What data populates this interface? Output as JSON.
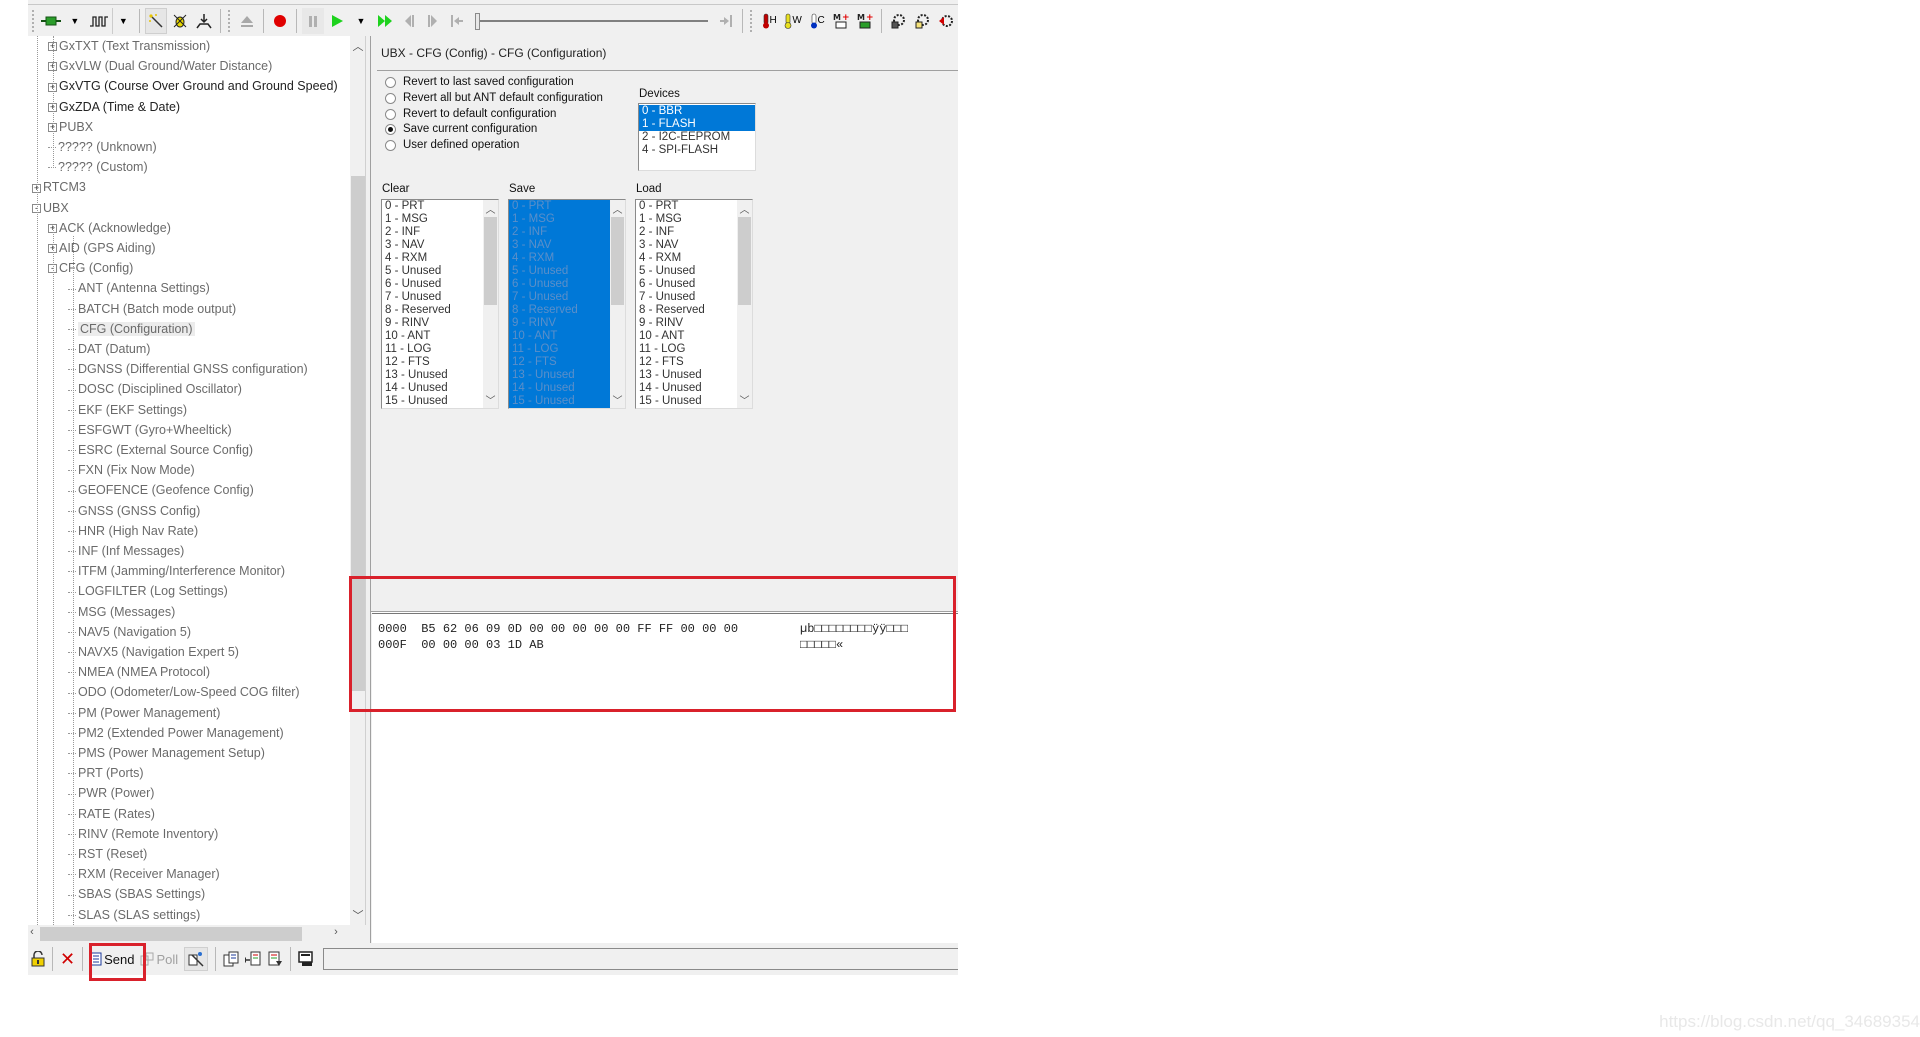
{
  "toolbar": {
    "icons": [
      "connection-icon",
      "baudrate-icon",
      "autobaud-icon",
      "debug-icon",
      "receive-icon",
      "eject-icon",
      "record-icon",
      "pause-icon",
      "play-icon",
      "play-menu-icon",
      "fast-forward-icon",
      "step-back-icon",
      "step-forward-icon",
      "go-start-icon",
      "go-end-icon",
      "hot-start-icon",
      "warm-start-icon",
      "cold-start-icon",
      "msg-disconnect-icon",
      "msg-connect-icon",
      "save-config-icon",
      "load-config-icon",
      "reset-config-icon"
    ],
    "thermo_labels": {
      "hot": "H",
      "warm": "W",
      "cold": "C"
    },
    "msg_label": "M",
    "playback_position": 0
  },
  "tree": {
    "items": [
      {
        "label": "GxTXT (Text Transmission)",
        "level": 1,
        "expander": "+",
        "bold": false
      },
      {
        "label": "GxVLW (Dual Ground/Water Distance)",
        "level": 1,
        "expander": "+",
        "bold": false
      },
      {
        "label": "GxVTG (Course Over Ground and Ground Speed)",
        "level": 1,
        "expander": "+",
        "bold": true
      },
      {
        "label": "GxZDA (Time & Date)",
        "level": 1,
        "expander": "+",
        "bold": true
      },
      {
        "label": "PUBX",
        "level": 1,
        "expander": "+",
        "bold": false
      },
      {
        "label": "????? (Unknown)",
        "level": 1,
        "expander": "",
        "bold": false
      },
      {
        "label": "????? (Custom)",
        "level": 1,
        "expander": "",
        "bold": false
      },
      {
        "label": "RTCM3",
        "level": 0,
        "expander": "+",
        "bold": false
      },
      {
        "label": "UBX",
        "level": 0,
        "expander": "-",
        "bold": false
      },
      {
        "label": "ACK (Acknowledge)",
        "level": 1,
        "expander": "+",
        "bold": false
      },
      {
        "label": "AID (GPS Aiding)",
        "level": 1,
        "expander": "+",
        "bold": false
      },
      {
        "label": "CFG (Config)",
        "level": 1,
        "expander": "-",
        "bold": false
      },
      {
        "label": "ANT (Antenna Settings)",
        "level": 2,
        "expander": "",
        "bold": false
      },
      {
        "label": "BATCH (Batch mode output)",
        "level": 2,
        "expander": "",
        "bold": false
      },
      {
        "label": "CFG (Configuration)",
        "level": 2,
        "expander": "",
        "bold": false,
        "selected": true
      },
      {
        "label": "DAT (Datum)",
        "level": 2,
        "expander": "",
        "bold": false
      },
      {
        "label": "DGNSS (Differential GNSS configuration)",
        "level": 2,
        "expander": "",
        "bold": false
      },
      {
        "label": "DOSC (Disciplined Oscillator)",
        "level": 2,
        "expander": "",
        "bold": false
      },
      {
        "label": "EKF (EKF Settings)",
        "level": 2,
        "expander": "",
        "bold": false
      },
      {
        "label": "ESFGWT (Gyro+Wheeltick)",
        "level": 2,
        "expander": "",
        "bold": false
      },
      {
        "label": "ESRC (External Source Config)",
        "level": 2,
        "expander": "",
        "bold": false
      },
      {
        "label": "FXN (Fix Now Mode)",
        "level": 2,
        "expander": "",
        "bold": false
      },
      {
        "label": "GEOFENCE (Geofence Config)",
        "level": 2,
        "expander": "",
        "bold": false
      },
      {
        "label": "GNSS (GNSS Config)",
        "level": 2,
        "expander": "",
        "bold": false
      },
      {
        "label": "HNR (High Nav Rate)",
        "level": 2,
        "expander": "",
        "bold": false
      },
      {
        "label": "INF (Inf Messages)",
        "level": 2,
        "expander": "",
        "bold": false
      },
      {
        "label": "ITFM (Jamming/Interference Monitor)",
        "level": 2,
        "expander": "",
        "bold": false
      },
      {
        "label": "LOGFILTER (Log Settings)",
        "level": 2,
        "expander": "",
        "bold": false
      },
      {
        "label": "MSG (Messages)",
        "level": 2,
        "expander": "",
        "bold": false
      },
      {
        "label": "NAV5 (Navigation 5)",
        "level": 2,
        "expander": "",
        "bold": false
      },
      {
        "label": "NAVX5 (Navigation Expert 5)",
        "level": 2,
        "expander": "",
        "bold": false
      },
      {
        "label": "NMEA (NMEA Protocol)",
        "level": 2,
        "expander": "",
        "bold": false
      },
      {
        "label": "ODO (Odometer/Low-Speed COG filter)",
        "level": 2,
        "expander": "",
        "bold": false
      },
      {
        "label": "PM (Power Management)",
        "level": 2,
        "expander": "",
        "bold": false
      },
      {
        "label": "PM2 (Extended Power Management)",
        "level": 2,
        "expander": "",
        "bold": false
      },
      {
        "label": "PMS (Power Management Setup)",
        "level": 2,
        "expander": "",
        "bold": false
      },
      {
        "label": "PRT (Ports)",
        "level": 2,
        "expander": "",
        "bold": false
      },
      {
        "label": "PWR (Power)",
        "level": 2,
        "expander": "",
        "bold": false
      },
      {
        "label": "RATE (Rates)",
        "level": 2,
        "expander": "",
        "bold": false
      },
      {
        "label": "RINV (Remote Inventory)",
        "level": 2,
        "expander": "",
        "bold": false
      },
      {
        "label": "RST (Reset)",
        "level": 2,
        "expander": "",
        "bold": false
      },
      {
        "label": "RXM (Receiver Manager)",
        "level": 2,
        "expander": "",
        "bold": false
      },
      {
        "label": "SBAS (SBAS Settings)",
        "level": 2,
        "expander": "",
        "bold": false
      },
      {
        "label": "SLAS (SLAS settings)",
        "level": 2,
        "expander": "",
        "bold": false
      }
    ]
  },
  "config": {
    "title": "UBX - CFG (Config) - CFG (Configuration)",
    "radios": [
      {
        "label": "Revert to last saved configuration",
        "checked": false
      },
      {
        "label": "Revert all but ANT default configuration",
        "checked": false
      },
      {
        "label": "Revert to default configuration",
        "checked": false
      },
      {
        "label": "Save current configuration",
        "checked": true
      },
      {
        "label": "User defined operation",
        "checked": false
      }
    ],
    "devices": {
      "label": "Devices",
      "items": [
        {
          "label": "0 - BBR",
          "selected": true
        },
        {
          "label": "1 - FLASH",
          "selected": true
        },
        {
          "label": "2 - I2C-EEPROM",
          "selected": false
        },
        {
          "label": "4 - SPI-FLASH",
          "selected": false
        }
      ]
    },
    "masks": [
      {
        "label": "Clear",
        "all_selected": false
      },
      {
        "label": "Save",
        "all_selected": true
      },
      {
        "label": "Load",
        "all_selected": false
      }
    ],
    "mask_items": [
      "0 - PRT",
      "1 - MSG",
      "2 - INF",
      "3 - NAV",
      "4 - RXM",
      "5 - Unused",
      "6 - Unused",
      "7 - Unused",
      "8 - Reserved",
      "9 - RINV",
      "10 - ANT",
      "11 - LOG",
      "12 - FTS",
      "13 - Unused",
      "14 - Unused",
      "15 - Unused"
    ]
  },
  "hex": {
    "rows": [
      {
        "offset": "0000",
        "bytes": "B5 62 06 09 0D 00 00 00 00 00 FF FF 00 00 00",
        "ascii": "µb□□□□□□□□ÿÿ□□□"
      },
      {
        "offset": "000F",
        "bytes": "00 00 00 03 1D AB",
        "ascii": "□□□□□«"
      }
    ]
  },
  "bottombar": {
    "send_label": "Send",
    "poll_label": "Poll",
    "icons": [
      "lock-icon",
      "close-icon",
      "send-icon",
      "poll-icon",
      "autoconfig-icon",
      "copy-icon",
      "import-icon",
      "export-icon",
      "keyboard-icon"
    ]
  },
  "watermark": "https://blog.csdn.net/qq_34689354",
  "colors": {
    "selection": "#0078d7",
    "highlight_box": "#d9212b"
  }
}
